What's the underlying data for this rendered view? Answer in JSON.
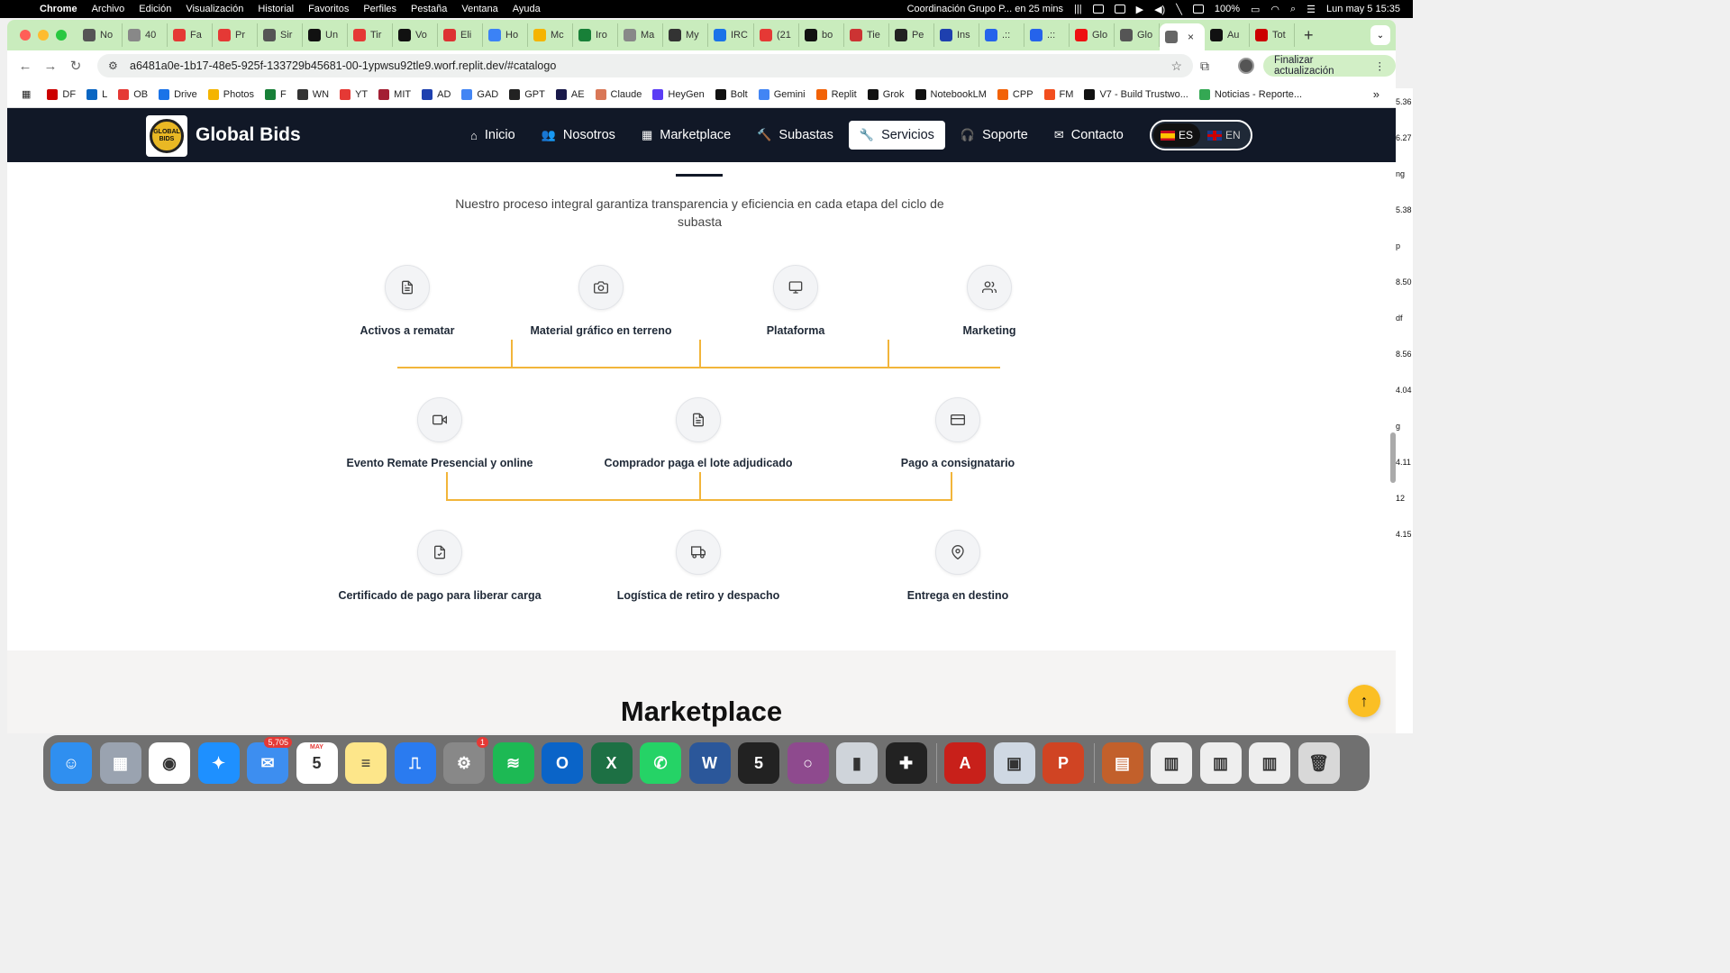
{
  "menubar": {
    "app": "Chrome",
    "items": [
      "Archivo",
      "Edición",
      "Visualización",
      "Historial",
      "Favoritos",
      "Perfiles",
      "Pestaña",
      "Ventana",
      "Ayuda"
    ],
    "event": "Coordinación Grupo P... en 25 mins",
    "battery": "100%",
    "clock": "Lun may 5  15:35"
  },
  "tabs": [
    {
      "label": "No",
      "color": "#555"
    },
    {
      "label": "40",
      "color": "#888"
    },
    {
      "label": "Fa",
      "color": "#e53935"
    },
    {
      "label": "Pr",
      "color": "#e53935"
    },
    {
      "label": "Sir",
      "color": "#555"
    },
    {
      "label": "Un",
      "color": "#111"
    },
    {
      "label": "Tir",
      "color": "#e53935"
    },
    {
      "label": "Vo",
      "color": "#111"
    },
    {
      "label": "Eli",
      "color": "#d33"
    },
    {
      "label": "Ho",
      "color": "#3b82f6"
    },
    {
      "label": "Mc",
      "color": "#f5b400"
    },
    {
      "label": "Iro",
      "color": "#188038"
    },
    {
      "label": "Ma",
      "color": "#888"
    },
    {
      "label": "My",
      "color": "#333"
    },
    {
      "label": "IRC",
      "color": "#1a73e8"
    },
    {
      "label": "(21",
      "color": "#e53935"
    },
    {
      "label": "bo",
      "color": "#111"
    },
    {
      "label": "Tie",
      "color": "#c33"
    },
    {
      "label": "Pe",
      "color": "#222"
    },
    {
      "label": "Ins",
      "color": "#1e40af"
    },
    {
      "label": ".::",
      "color": "#2563eb"
    },
    {
      "label": ".::",
      "color": "#2563eb"
    },
    {
      "label": "Glo",
      "color": "#e11"
    },
    {
      "label": "Glo",
      "color": "#555"
    }
  ],
  "active_tab": {
    "label": "",
    "close": "×"
  },
  "tabs_after": [
    {
      "label": "Au",
      "color": "#111"
    },
    {
      "label": "Tot",
      "color": "#c00"
    }
  ],
  "url": "a6481a0e-1b17-48e5-925f-133729b45681-00-1ypwsu92tle9.worf.replit.dev/#catalogo",
  "update_button": "Finalizar actualización",
  "bookmarks": [
    {
      "label": "DF",
      "color": "#c00"
    },
    {
      "label": "L",
      "color": "#0a66c2"
    },
    {
      "label": "OB",
      "color": "#e53935"
    },
    {
      "label": "Drive",
      "color": "#1a73e8"
    },
    {
      "label": "Photos",
      "color": "#f4b400"
    },
    {
      "label": "F",
      "color": "#188038"
    },
    {
      "label": "WN",
      "color": "#333"
    },
    {
      "label": "YT",
      "color": "#e53935"
    },
    {
      "label": "MIT",
      "color": "#a31f34"
    },
    {
      "label": "AD",
      "color": "#1e40af"
    },
    {
      "label": "GAD",
      "color": "#4285f4"
    },
    {
      "label": "GPT",
      "color": "#222"
    },
    {
      "label": "AE",
      "color": "#1a1a4a"
    },
    {
      "label": "Claude",
      "color": "#d97757"
    },
    {
      "label": "HeyGen",
      "color": "#5b3df5"
    },
    {
      "label": "Bolt",
      "color": "#111"
    },
    {
      "label": "Gemini",
      "color": "#4285f4"
    },
    {
      "label": "Replit",
      "color": "#f26207"
    },
    {
      "label": "Grok",
      "color": "#111"
    },
    {
      "label": "NotebookLM",
      "color": "#111"
    },
    {
      "label": "CPP",
      "color": "#f26207"
    },
    {
      "label": "FM",
      "color": "#f24e1e"
    },
    {
      "label": "V7 - Build Trustwo...",
      "color": "#111"
    },
    {
      "label": "Noticias - Reporte...",
      "color": "#34a853"
    }
  ],
  "site": {
    "brand": "Global Bids",
    "logo_text": "GLOBAL BIDS",
    "nav": [
      {
        "label": "Inicio",
        "icon": "⌂"
      },
      {
        "label": "Nosotros",
        "icon": "👥"
      },
      {
        "label": "Marketplace",
        "icon": "▦"
      },
      {
        "label": "Subastas",
        "icon": "🔨"
      },
      {
        "label": "Servicios",
        "icon": "🔧"
      },
      {
        "label": "Soporte",
        "icon": "🎧"
      },
      {
        "label": "Contacto",
        "icon": "✉"
      }
    ],
    "lang": {
      "es": "ES",
      "en": "EN"
    },
    "subtitle": "Nuestro proceso integral garantiza transparencia y eficiencia en cada etapa del ciclo de subasta",
    "row1": [
      {
        "label": "Activos a rematar",
        "icon": "doc"
      },
      {
        "label": "Material gráfico en terreno",
        "icon": "camera"
      },
      {
        "label": "Plataforma",
        "icon": "monitor"
      },
      {
        "label": "Marketing",
        "icon": "users"
      }
    ],
    "row2": [
      {
        "label": "Evento Remate Presencial y online",
        "icon": "video"
      },
      {
        "label": "Comprador paga el lote adjudicado",
        "icon": "doc"
      },
      {
        "label": "Pago a consignatario",
        "icon": "card"
      }
    ],
    "row3": [
      {
        "label": "Certificado de pago para liberar carga",
        "icon": "filecheck"
      },
      {
        "label": "Logística de retiro y despacho",
        "icon": "truck"
      },
      {
        "label": "Entrega en destino",
        "icon": "pin"
      }
    ],
    "next_section_title": "Marketplace"
  },
  "right_strip": [
    "5.36",
    "6.27",
    "ng",
    "5.38",
    "p",
    "8.50",
    "df",
    "8.56",
    "4.04",
    "g",
    "4.11",
    "12",
    "4.15"
  ],
  "dock": [
    {
      "name": "finder",
      "color": "#2f8ff0",
      "glyph": "☺"
    },
    {
      "name": "launchpad",
      "color": "#9aa3b0",
      "glyph": "▦"
    },
    {
      "name": "chrome",
      "color": "#ffffff",
      "glyph": "◉"
    },
    {
      "name": "safari",
      "color": "#1e90ff",
      "glyph": "✦"
    },
    {
      "name": "mail",
      "color": "#3d8ef0",
      "glyph": "✉",
      "badge": "5,705"
    },
    {
      "name": "calendar",
      "color": "#ffffff",
      "glyph": "5",
      "top": "MAY"
    },
    {
      "name": "notes",
      "color": "#fde68a",
      "glyph": "≡"
    },
    {
      "name": "keynote",
      "color": "#2a7bf0",
      "glyph": "⎍"
    },
    {
      "name": "settings",
      "color": "#888",
      "glyph": "⚙",
      "badge": "1"
    },
    {
      "name": "spotify",
      "color": "#1db954",
      "glyph": "≋"
    },
    {
      "name": "outlook",
      "color": "#0a64c8",
      "glyph": "O"
    },
    {
      "name": "excel",
      "color": "#1d7044",
      "glyph": "X"
    },
    {
      "name": "whatsapp",
      "color": "#25d366",
      "glyph": "✆"
    },
    {
      "name": "word",
      "color": "#2b579a",
      "glyph": "W"
    },
    {
      "name": "calendar-5",
      "color": "#222",
      "glyph": "5"
    },
    {
      "name": "circle-app",
      "color": "#8e4a8e",
      "glyph": "○"
    },
    {
      "name": "simulator",
      "color": "#cfd4da",
      "glyph": "▮"
    },
    {
      "name": "shape-app",
      "color": "#222",
      "glyph": "✚"
    },
    {
      "name": "acrobat",
      "color": "#c8201a",
      "glyph": "A"
    },
    {
      "name": "preview",
      "color": "#cfd8e3",
      "glyph": "▣"
    },
    {
      "name": "powerpoint",
      "color": "#d04423",
      "glyph": "P"
    },
    {
      "name": "folder-1",
      "color": "#c2602b",
      "glyph": "▤"
    },
    {
      "name": "doc-1",
      "color": "#eee",
      "glyph": "▥"
    },
    {
      "name": "doc-2",
      "color": "#eee",
      "glyph": "▥"
    },
    {
      "name": "doc-3",
      "color": "#eee",
      "glyph": "▥"
    },
    {
      "name": "trash",
      "color": "#d8d8d8",
      "glyph": "🗑"
    }
  ]
}
